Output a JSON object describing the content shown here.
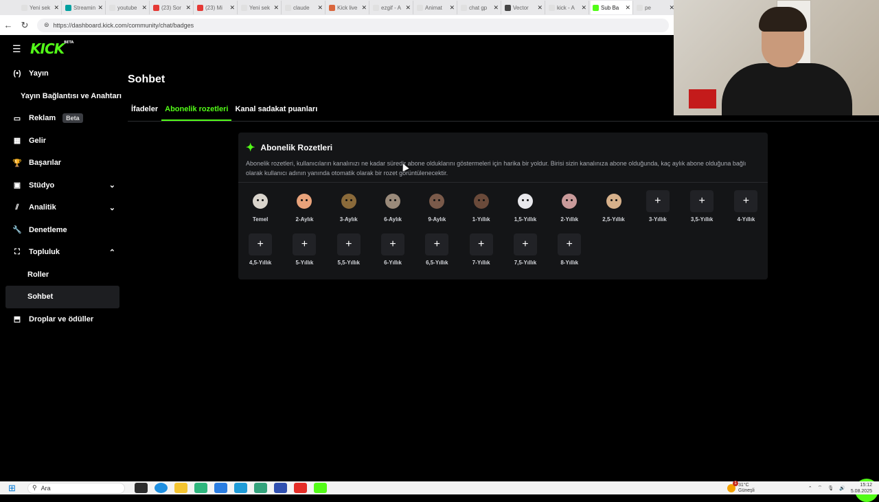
{
  "browser": {
    "tabs": [
      {
        "label": "Yeni sek",
        "color": "#e0e0e0"
      },
      {
        "label": "Streamin",
        "color": "#00a0a0"
      },
      {
        "label": "youtube",
        "color": "#e0e0e0"
      },
      {
        "label": "(23) Sor",
        "color": "#e53935"
      },
      {
        "label": "(23) Mi",
        "color": "#e53935"
      },
      {
        "label": "Yeni sek",
        "color": "#e0e0e0"
      },
      {
        "label": "claude",
        "color": "#e0e0e0"
      },
      {
        "label": "Kick live",
        "color": "#d9663d"
      },
      {
        "label": "ezgif - A",
        "color": "#e0e0e0"
      },
      {
        "label": "Animat",
        "color": "#e0e0e0"
      },
      {
        "label": "chat gp",
        "color": "#e0e0e0"
      },
      {
        "label": "Vector",
        "color": "#444444"
      },
      {
        "label": "kick - A",
        "color": "#e0e0e0"
      },
      {
        "label": "Sub Ba",
        "color": "#53fc18",
        "active": true
      },
      {
        "label": "pe",
        "color": "#e0e0e0"
      }
    ],
    "url": "https://dashboard.kick.com/community/chat/badges"
  },
  "sidebar": {
    "logo": "KICK",
    "logo_sup": "BETA",
    "items": [
      {
        "label": "Yayın",
        "icon": "broadcast-icon",
        "glyph": "(•)"
      },
      {
        "label": "Yayın Bağlantısı ve Anahtarı",
        "icon": "",
        "glyph": ""
      },
      {
        "label": "Reklam",
        "icon": "ad-icon",
        "glyph": "▭",
        "badge": "Beta"
      },
      {
        "label": "Gelir",
        "icon": "revenue-icon",
        "glyph": "▦"
      },
      {
        "label": "Başarılar",
        "icon": "trophy-icon",
        "glyph": "🏆"
      },
      {
        "label": "Stüdyo",
        "icon": "studio-icon",
        "glyph": "▣",
        "chevron": "⌄"
      },
      {
        "label": "Analitik",
        "icon": "analytics-icon",
        "glyph": "⫽",
        "chevron": "⌄"
      },
      {
        "label": "Denetleme",
        "icon": "wrench-icon",
        "glyph": "🔧"
      },
      {
        "label": "Topluluk",
        "icon": "community-icon",
        "glyph": "⛶",
        "chevron": "⌃"
      },
      {
        "label": "Roller",
        "icon": "",
        "glyph": ""
      },
      {
        "label": "Sohbet",
        "icon": "",
        "glyph": ""
      },
      {
        "label": "Droplar ve ödüller",
        "icon": "drops-icon",
        "glyph": "⬒"
      }
    ]
  },
  "main": {
    "title": "Sohbet",
    "tabs": [
      "İfadeler",
      "Abonelik rozetleri",
      "Kanal sadakat puanları"
    ],
    "active_tab": 1
  },
  "card": {
    "title": "Abonelik Rozetleri",
    "description": "Abonelik rozetleri, kullanıcıların kanalınızı ne kadar süredir abone olduklarını göstermeleri için harika bir yoldur. Birisi sizin kanalınıza abone olduğunda, kaç aylık abone olduğuna bağlı olarak kullanıcı adının yanında otomatik olarak bir rozet görüntülenecektir.",
    "badges": [
      {
        "label": "Temel",
        "filled": true,
        "color": "#d9d4cc"
      },
      {
        "label": "2-Aylık",
        "filled": true,
        "color": "#e8a27a"
      },
      {
        "label": "3-Aylık",
        "filled": true,
        "color": "#8a6a3a"
      },
      {
        "label": "6-Aylık",
        "filled": true,
        "color": "#9a8a7a"
      },
      {
        "label": "9-Aylık",
        "filled": true,
        "color": "#7a5a4a"
      },
      {
        "label": "1-Yıllık",
        "filled": true,
        "color": "#6a4a3a"
      },
      {
        "label": "1,5-Yıllık",
        "filled": true,
        "color": "#e8e8ec"
      },
      {
        "label": "2-Yıllık",
        "filled": true,
        "color": "#c99a9a"
      },
      {
        "label": "2,5-Yıllık",
        "filled": true,
        "color": "#d6b08a"
      },
      {
        "label": "3-Yıllık",
        "filled": false
      },
      {
        "label": "3,5-Yıllık",
        "filled": false
      },
      {
        "label": "4-Yıllık",
        "filled": false
      },
      {
        "label": "4,5-Yıllık",
        "filled": false
      },
      {
        "label": "5-Yıllık",
        "filled": false
      },
      {
        "label": "5,5-Yıllık",
        "filled": false
      },
      {
        "label": "6-Yıllık",
        "filled": false
      },
      {
        "label": "6,5-Yıllık",
        "filled": false
      },
      {
        "label": "7-Yıllık",
        "filled": false
      },
      {
        "label": "7,5-Yıllık",
        "filled": false
      },
      {
        "label": "8-Yıllık",
        "filled": false
      }
    ],
    "add_glyph": "+"
  },
  "taskbar": {
    "search": "Ara",
    "weather_temp": "31°C",
    "weather_desc": "Güneşli",
    "time": "15:12",
    "date": "5.08.2025",
    "notif_count": "1"
  }
}
